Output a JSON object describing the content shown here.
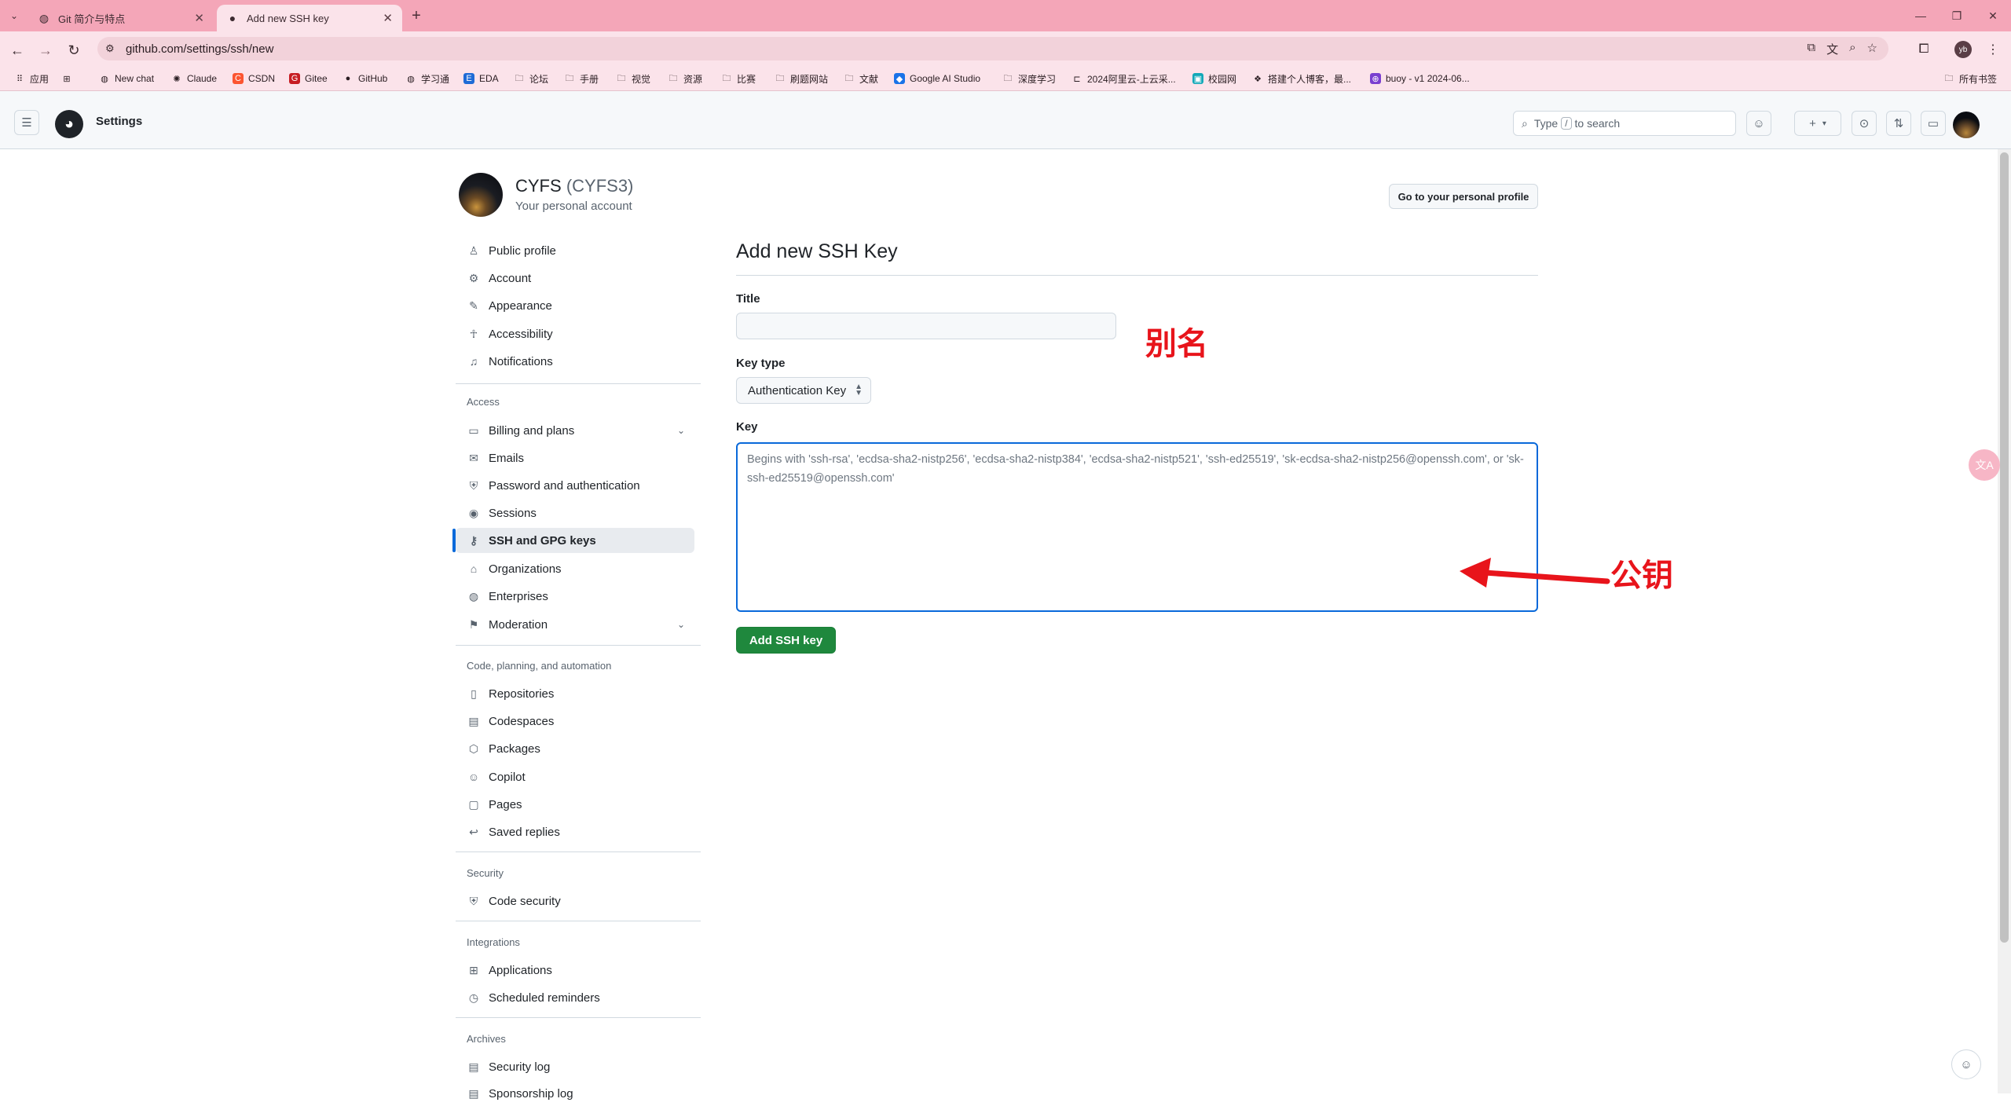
{
  "browser": {
    "tabs": [
      {
        "title": "Git 简介与特点",
        "icon": "globe-icon"
      },
      {
        "title": "Add new SSH key",
        "icon": "github-icon"
      }
    ],
    "url": "github.com/settings/ssh/new",
    "profile_initials": "yb",
    "bookmarks": [
      {
        "label": "应用",
        "icon": "apps-grid-icon"
      },
      {
        "label": "",
        "icon": "grid-icon"
      },
      {
        "label": "New chat",
        "icon": "chat-icon"
      },
      {
        "label": "Claude",
        "icon": "claude-icon"
      },
      {
        "label": "CSDN",
        "icon": "csdn-icon"
      },
      {
        "label": "Gitee",
        "icon": "gitee-icon"
      },
      {
        "label": "GitHub",
        "icon": "github-icon"
      },
      {
        "label": "学习通",
        "icon": "globe-icon"
      },
      {
        "label": "EDA",
        "icon": "eda-icon"
      },
      {
        "label": "论坛",
        "icon": "folder-icon"
      },
      {
        "label": "手册",
        "icon": "folder-icon"
      },
      {
        "label": "视觉",
        "icon": "folder-icon"
      },
      {
        "label": "资源",
        "icon": "folder-icon"
      },
      {
        "label": "比赛",
        "icon": "folder-icon"
      },
      {
        "label": "刷题网站",
        "icon": "folder-icon"
      },
      {
        "label": "文献",
        "icon": "folder-icon"
      },
      {
        "label": "Google AI Studio",
        "icon": "ai-studio-icon"
      },
      {
        "label": "深度学习",
        "icon": "folder-icon"
      },
      {
        "label": "2024阿里云-上云采...",
        "icon": "aliyun-icon"
      },
      {
        "label": "校园网",
        "icon": "campus-net-icon"
      },
      {
        "label": "搭建个人博客，最...",
        "icon": "blog-icon"
      },
      {
        "label": "buoy - v1 2024-06...",
        "icon": "buoy-icon"
      }
    ],
    "all_bookmarks_label": "所有书签"
  },
  "header": {
    "context": "Settings",
    "search_prefix": "Type",
    "search_key": "/",
    "search_suffix": "to search"
  },
  "account": {
    "name": "CYFS",
    "login": "(CYFS3)",
    "subtitle": "Your personal account",
    "profile_button": "Go to your personal profile"
  },
  "sidebar": {
    "top": [
      {
        "label": "Public profile",
        "icon": "person-icon"
      },
      {
        "label": "Account",
        "icon": "gear-icon"
      },
      {
        "label": "Appearance",
        "icon": "paintbrush-icon"
      },
      {
        "label": "Accessibility",
        "icon": "accessibility-icon"
      },
      {
        "label": "Notifications",
        "icon": "bell-icon"
      }
    ],
    "access_heading": "Access",
    "access": [
      {
        "label": "Billing and plans",
        "icon": "credit-card-icon"
      },
      {
        "label": "Emails",
        "icon": "mail-icon"
      },
      {
        "label": "Password and authentication",
        "icon": "shield-lock-icon"
      },
      {
        "label": "Sessions",
        "icon": "broadcast-icon"
      },
      {
        "label": "SSH and GPG keys",
        "icon": "key-icon"
      },
      {
        "label": "Organizations",
        "icon": "organization-icon"
      },
      {
        "label": "Enterprises",
        "icon": "globe-icon"
      },
      {
        "label": "Moderation",
        "icon": "report-icon"
      }
    ],
    "code_heading": "Code, planning, and automation",
    "code": [
      {
        "label": "Repositories",
        "icon": "repo-icon"
      },
      {
        "label": "Codespaces",
        "icon": "codespaces-icon"
      },
      {
        "label": "Packages",
        "icon": "package-icon"
      },
      {
        "label": "Copilot",
        "icon": "copilot-icon"
      },
      {
        "label": "Pages",
        "icon": "browser-icon"
      },
      {
        "label": "Saved replies",
        "icon": "reply-icon"
      }
    ],
    "security_heading": "Security",
    "security": [
      {
        "label": "Code security",
        "icon": "shield-icon"
      }
    ],
    "integrations_heading": "Integrations",
    "integrations": [
      {
        "label": "Applications",
        "icon": "apps-icon"
      },
      {
        "label": "Scheduled reminders",
        "icon": "clock-icon"
      }
    ],
    "archives_heading": "Archives",
    "archives": [
      {
        "label": "Security log",
        "icon": "log-icon"
      },
      {
        "label": "Sponsorship log",
        "icon": "log-icon"
      }
    ]
  },
  "form": {
    "heading": "Add new SSH Key",
    "title_label": "Title",
    "title_value": "",
    "key_type_label": "Key type",
    "key_type_value": "Authentication Key",
    "key_label": "Key",
    "key_placeholder": "Begins with 'ssh-rsa', 'ecdsa-sha2-nistp256', 'ecdsa-sha2-nistp384', 'ecdsa-sha2-nistp521', 'ssh-ed25519', 'sk-ecdsa-sha2-nistp256@openssh.com', or 'sk-ssh-ed25519@openssh.com'",
    "submit_label": "Add SSH key"
  },
  "annotations": {
    "title_note": "别名",
    "key_note": "公钥",
    "color": "#e8141b"
  },
  "colors": {
    "accent": "#0969da",
    "primary_button": "#1f883d",
    "browser_frame": "#f4a6b8"
  }
}
